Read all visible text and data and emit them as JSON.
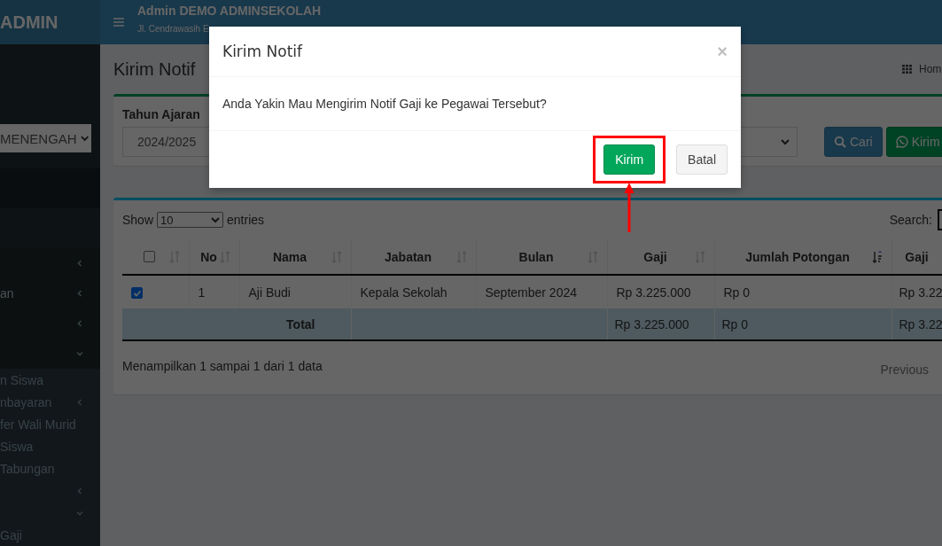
{
  "header": {
    "logo": "ADMIN",
    "title": "Admin DEMO ADMINSEKOLAH",
    "subtitle": "Jl. Cendrawasih E"
  },
  "sidebar": {
    "level_select": "MENENGAH",
    "items": [
      {
        "expanded": false
      },
      {
        "label": "an",
        "expanded": false
      },
      {
        "expanded": false
      },
      {
        "expanded": true,
        "children": [
          {
            "label": "n Siswa"
          },
          {
            "label": "nbayaran",
            "expanded": false
          },
          {
            "label": "fer Wali Murid"
          },
          {
            "label": "Siswa"
          },
          {
            "label": "Tabungan"
          },
          {
            "expanded": false
          },
          {
            "expanded": true,
            "children": [
              {
                "label": "Gaji"
              }
            ]
          }
        ]
      }
    ]
  },
  "page": {
    "title": "Kirim Notif",
    "breadcrumb": "Hom"
  },
  "filter": {
    "label": "Tahun Ajaran",
    "year": "2024/2025",
    "buttons": [
      {
        "label": "Cari",
        "kind": "search"
      },
      {
        "label": "Kirim",
        "kind": "send"
      }
    ]
  },
  "table_controls": {
    "show": "Show",
    "length": "10",
    "entries": "entries",
    "search": "Search:"
  },
  "table": {
    "select_all": {
      "checked": false,
      "sorted": false
    },
    "columns": [
      {
        "label": "No",
        "sorted": false
      },
      {
        "label": "Nama",
        "sorted": false
      },
      {
        "label": "Jabatan",
        "sorted": false
      },
      {
        "label": "Bulan",
        "sorted": false
      },
      {
        "label": "Gaji",
        "sorted": false
      },
      {
        "label": "Jumlah Potongan",
        "sorted": true
      },
      {
        "label": "Gaji"
      }
    ],
    "rows": [
      {
        "checked": true,
        "cells": [
          "1",
          "Aji Budi",
          "Kepala Sekolah",
          "September 2024",
          "Rp 3.225.000",
          "Rp 0",
          "Rp 3.22"
        ]
      }
    ],
    "total": {
      "label": "Total",
      "cells": [
        "Rp 3.225.000",
        "Rp 0",
        "Rp 3.22"
      ]
    }
  },
  "table_footer": {
    "info": "Menampilkan 1 sampai 1 dari 1 data",
    "previous": "Previous"
  },
  "modal": {
    "title": "Kirim Notif",
    "close": "×",
    "message": "Anda Yakin Mau Mengirim Notif Gaji ke Pegawai Tersebut?",
    "buttons": [
      {
        "label": "Kirim",
        "kind": "primary",
        "highlighted": true
      },
      {
        "label": "Batal",
        "kind": "default",
        "highlighted": false
      }
    ]
  }
}
